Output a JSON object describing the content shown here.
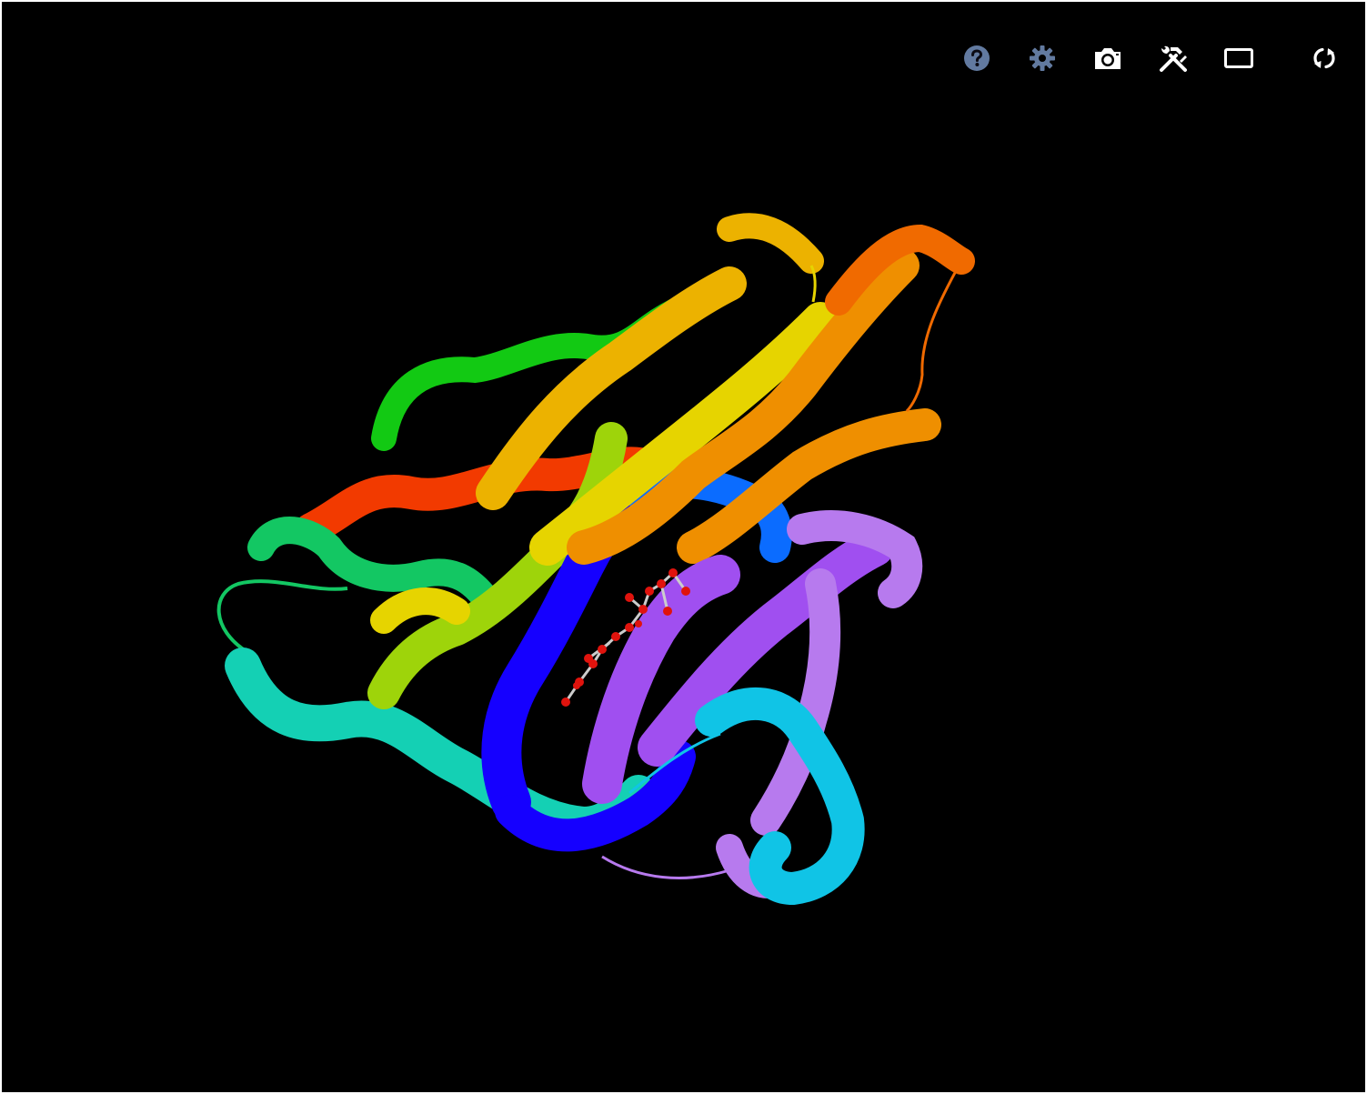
{
  "toolbar": {
    "buttons": [
      {
        "name": "help",
        "icon": "question-circle-icon"
      },
      {
        "name": "settings",
        "icon": "gear-icon"
      },
      {
        "name": "screenshot",
        "icon": "camera-icon"
      },
      {
        "name": "controls",
        "icon": "tools-icon"
      },
      {
        "name": "expand",
        "icon": "rectangle-icon"
      },
      {
        "name": "reset",
        "icon": "reset-arrows-icon"
      }
    ]
  },
  "colors": {
    "background": "#000000",
    "toolbar_muted": "#627aa0",
    "toolbar_active": "#ffffff",
    "rainbow": [
      "#1500ff",
      "#0b6cff",
      "#10c4e6",
      "#14d0b4",
      "#13c763",
      "#13d414",
      "#9ed40a",
      "#e6d400",
      "#ecb200",
      "#ef8f00",
      "#f06a00",
      "#f23a00",
      "#a04ff0",
      "#b77aee"
    ]
  }
}
